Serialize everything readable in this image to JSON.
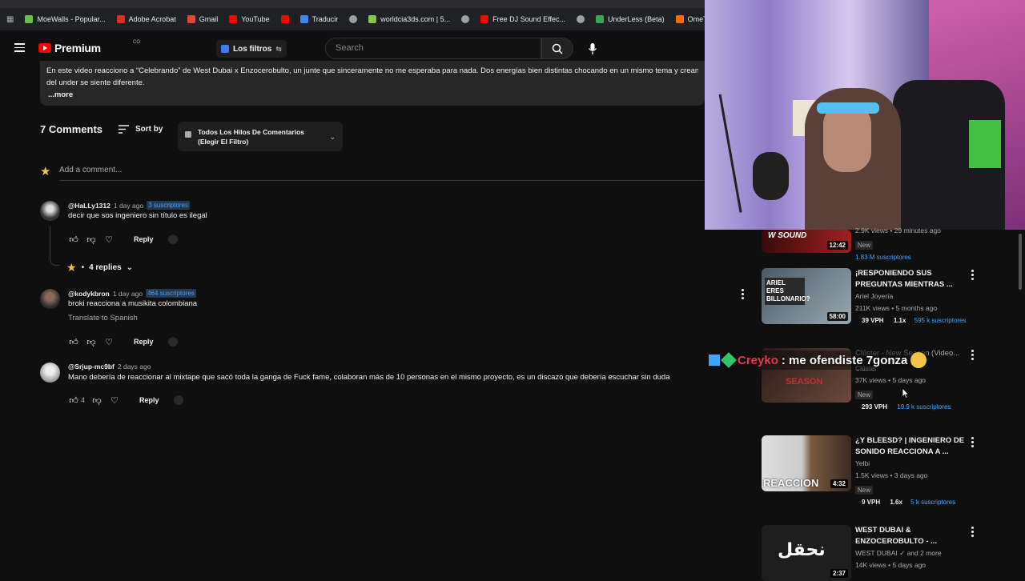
{
  "bookmarks": [
    {
      "label": "MoeWalls - Popular...",
      "color": "#6abf4b"
    },
    {
      "label": "Adobe Acrobat",
      "color": "#d93025"
    },
    {
      "label": "Gmail",
      "color": "#ea4335"
    },
    {
      "label": "YouTube",
      "color": "#ff0000"
    },
    {
      "label": "",
      "color": "#ff0000"
    },
    {
      "label": "Traducir",
      "color": "#4285f4"
    },
    {
      "label": "",
      "color": "#9aa0a6"
    },
    {
      "label": "worldcia3ds.com | 5...",
      "color": "#8bc34a"
    },
    {
      "label": "",
      "color": "#9aa0a6"
    },
    {
      "label": "Free DJ Sound Effec...",
      "color": "#ff0000"
    },
    {
      "label": "",
      "color": "#9aa0a6"
    },
    {
      "label": "UnderLess (Beta)",
      "color": "#34a853"
    },
    {
      "label": "OmeTV Video Chat...",
      "color": "#ff6d00"
    }
  ],
  "header": {
    "logo_text": "Premium",
    "logo_sup": "CO",
    "filters_label": "Los filtros",
    "search_placeholder": "Search"
  },
  "description": {
    "line1": "En este video reacciono a “Celebrando” de West Dubai x Enzocerobulto, un junte que sinceramente no me esperaba para nada. Dos energías bien distintas chocando en un mismo tema y creando algo",
    "line2": "del under se siente diferente.",
    "more": "...more"
  },
  "comments_header": {
    "count": "7 Comments",
    "sort_label": "Sort by",
    "threads_label": "Todos Los Hilos De Comentarios (Elegir El Filtro)",
    "add_placeholder": "Add a comment..."
  },
  "comments": [
    {
      "author": "@HaLLy1312",
      "time": "1 day ago",
      "badge": "3 suscriptores",
      "text": "decir que sos ingeniero sin título es ilegal",
      "likes": "",
      "reply": "Reply",
      "replies": "4 replies"
    },
    {
      "author": "@kodykbron",
      "time": "1 day ago",
      "badge": "464 suscriptores",
      "text": "broki reacciona a musikita colombiana",
      "translate": "Translate to Spanish",
      "likes": "",
      "reply": "Reply"
    },
    {
      "author": "@Srjup-mc9bf",
      "time": "2 days ago",
      "badge": "",
      "text": "Mano debería de reaccionar al mixtape que sacó toda la ganga de Fuck fame, colaboran más de 10 personas en el mismo proyecto, es un discazo que debería escuchar sin duda",
      "likes": "4",
      "reply": "Reply"
    }
  ],
  "chat_overlay": {
    "name": "Creyko",
    "message": ": me ofendiste 7gonza"
  },
  "sidebar_videos": [
    {
      "title": "",
      "channel": "",
      "stats": "2.9K views • 29 minutes ago",
      "new": "New",
      "vph": "",
      "mult": "",
      "subs": "1.83 M suscriptores",
      "duration": "12:42",
      "thumb_text": "W SOUND",
      "thumb_color": "#7a1a1a"
    },
    {
      "title": "¡RESPONIENDO SUS PREGUNTAS MIENTRAS ...",
      "channel": "Ariel Joyería",
      "stats": "211K views • 5 months ago",
      "new": "",
      "vph": "39 VPH",
      "mult": "1.1x",
      "subs": "595 k suscriptores",
      "duration": "58:00",
      "thumb_text": "ARIEL ERES BILLONARIO?",
      "thumb_color": "#6b7a88"
    },
    {
      "title": "Clúster - New Season (Video...",
      "channel": "Clúster",
      "stats": "37K views • 5 days ago",
      "new": "New",
      "vph": "293 VPH",
      "mult": "",
      "subs": "19.9 k suscriptores",
      "duration": "",
      "thumb_text": "SEASON",
      "thumb_color": "#4a2a2a"
    },
    {
      "title": "¿Y BLEESD? | INGENIERO DE SONIDO REACCIONA A ...",
      "channel": "Yelbi",
      "stats": "1.5K views • 3 days ago",
      "new": "New",
      "vph": "9 VPH",
      "mult": "1.6x",
      "subs": "5 k suscriptores",
      "duration": "4:32",
      "thumb_text": "REACCION",
      "thumb_color": "#8a6a40"
    },
    {
      "title": "WEST DUBAI & ENZOCEROBULTO - ...",
      "channel": "WEST DUBAI ✓ and 2 more",
      "stats": "14K views • 5 days ago",
      "new": "",
      "vph": "",
      "mult": "",
      "subs": "",
      "duration": "2:37",
      "thumb_text": "نحقل",
      "thumb_color": "#2c2c2c"
    }
  ],
  "colors": {
    "accent_blue": "#3ea6ff",
    "brand_red": "#ff0000",
    "background": "#0f0f0f",
    "chat_name": "#e6384a"
  }
}
